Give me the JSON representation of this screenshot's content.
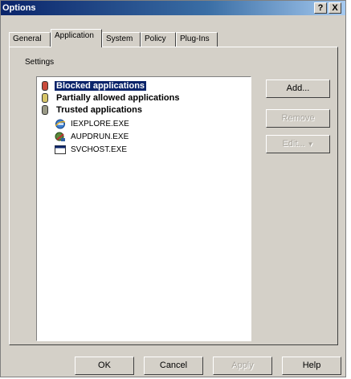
{
  "window": {
    "title": "Options",
    "help_button": "?",
    "close_button": "X"
  },
  "tabs": [
    {
      "label": "General"
    },
    {
      "label": "Application"
    },
    {
      "label": "System"
    },
    {
      "label": "Policy"
    },
    {
      "label": "Plug-Ins"
    }
  ],
  "settings": {
    "group_label": "Settings",
    "categories": [
      {
        "label": "Blocked applications",
        "icon": "red-lock-icon",
        "selected": true
      },
      {
        "label": "Partially allowed applications",
        "icon": "yellow-lock-icon"
      },
      {
        "label": "Trusted applications",
        "icon": "gray-lock-icon"
      }
    ],
    "trusted_apps": [
      {
        "label": "IEXPLORE.EXE",
        "icon": "internet-explorer-icon"
      },
      {
        "label": "AUPDRUN.EXE",
        "icon": "update-icon"
      },
      {
        "label": "SVCHOST.EXE",
        "icon": "window-app-icon"
      }
    ]
  },
  "side_buttons": {
    "add": "Add...",
    "remove": "Remove",
    "edit": "Edit..."
  },
  "footer_buttons": {
    "ok": "OK",
    "cancel": "Cancel",
    "apply": "Apply",
    "help": "Help"
  },
  "colors": {
    "title_bar": "#0a246a",
    "selection": "#0a246a",
    "dialog_face": "#d4d0c8"
  }
}
